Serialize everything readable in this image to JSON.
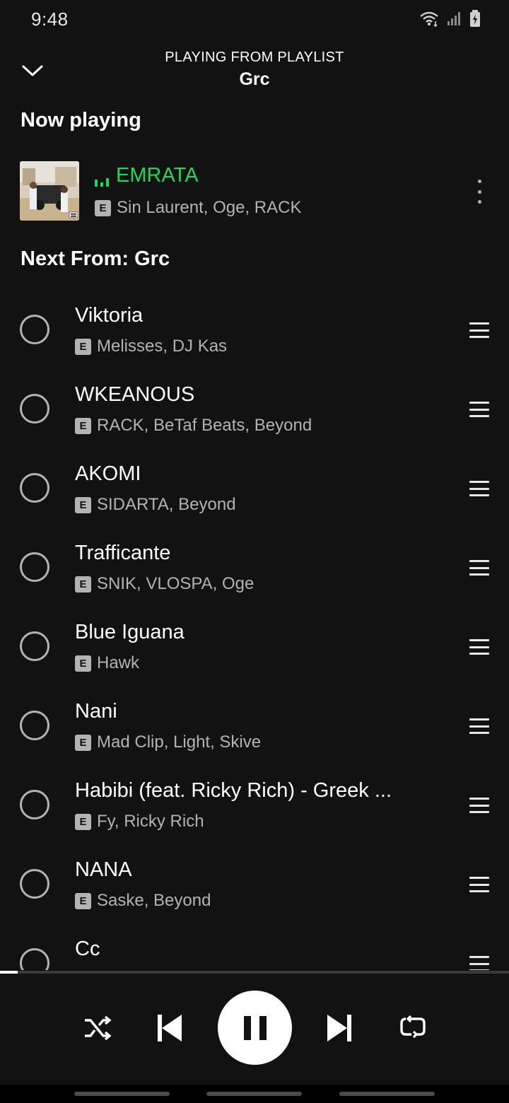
{
  "status_bar": {
    "time": "9:48"
  },
  "header": {
    "context_label": "PLAYING FROM PLAYLIST",
    "context_name": "Grc"
  },
  "now_playing": {
    "section_title": "Now playing",
    "title": "EMRATA",
    "explicit_badge": "E",
    "artists": "Sin Laurent, Oge, RACK"
  },
  "queue": {
    "section_title": "Next From: Grc",
    "tracks": [
      {
        "title": "Viktoria",
        "explicit": "E",
        "artists": "Melisses, DJ Kas"
      },
      {
        "title": "WKEANOUS",
        "explicit": "E",
        "artists": "RACK, BeTaf Beats, Beyond"
      },
      {
        "title": "AKOMI",
        "explicit": "E",
        "artists": "SIDARTA, Beyond"
      },
      {
        "title": "Trafficante",
        "explicit": "E",
        "artists": "SNIK, VLOSPA, Oge"
      },
      {
        "title": "Blue Iguana",
        "explicit": "E",
        "artists": "Hawk"
      },
      {
        "title": "Nani",
        "explicit": "E",
        "artists": "Mad Clip, Light, Skive"
      },
      {
        "title": "Habibi (feat. Ricky Rich) - Greek ...",
        "explicit": "E",
        "artists": "Fy, Ricky Rich"
      },
      {
        "title": "NANA",
        "explicit": "E",
        "artists": "Saske, Beyond"
      },
      {
        "title": "Cc",
        "explicit": "",
        "artists": ""
      }
    ]
  },
  "player": {
    "progress_fraction": 0.035,
    "state": "playing"
  },
  "colors": {
    "background": "#121212",
    "accent_green": "#1ed760",
    "secondary_text": "#b3b3b3"
  },
  "icons": {
    "collapse": "chevron-down-icon",
    "more": "more-vertical-icon",
    "shuffle": "shuffle-icon",
    "previous": "skip-previous-icon",
    "pause": "pause-icon",
    "next": "skip-next-icon",
    "repeat": "repeat-icon",
    "drag": "drag-handle-icon",
    "select": "select-circle-icon"
  }
}
